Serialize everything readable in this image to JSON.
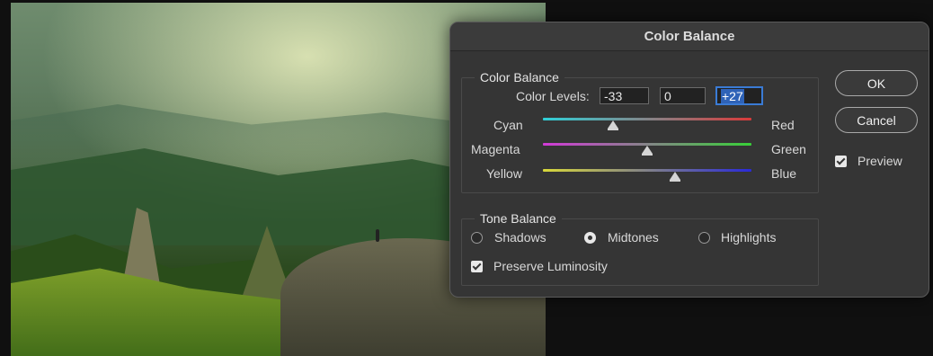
{
  "dialog": {
    "title": "Color Balance",
    "color_balance": {
      "group_label": "Color Balance",
      "levels_label": "Color Levels:",
      "levels": [
        "-33",
        "0",
        "+27"
      ],
      "sliders": [
        {
          "left": "Cyan",
          "right": "Red",
          "value": -33,
          "left_color": "#2fd0d8",
          "right_color": "#d83a3a"
        },
        {
          "left": "Magenta",
          "right": "Green",
          "value": 0,
          "left_color": "#d23ad8",
          "right_color": "#38d038"
        },
        {
          "left": "Yellow",
          "right": "Blue",
          "value": 27,
          "left_color": "#d8d83a",
          "right_color": "#2a2ad8"
        }
      ],
      "range": [
        -100,
        100
      ]
    },
    "tone_balance": {
      "group_label": "Tone Balance",
      "options": [
        "Shadows",
        "Midtones",
        "Highlights"
      ],
      "selected": "Midtones",
      "preserve_luminosity_label": "Preserve Luminosity",
      "preserve_luminosity": true
    },
    "buttons": {
      "ok": "OK",
      "cancel": "Cancel"
    },
    "preview_label": "Preview",
    "preview": true
  }
}
